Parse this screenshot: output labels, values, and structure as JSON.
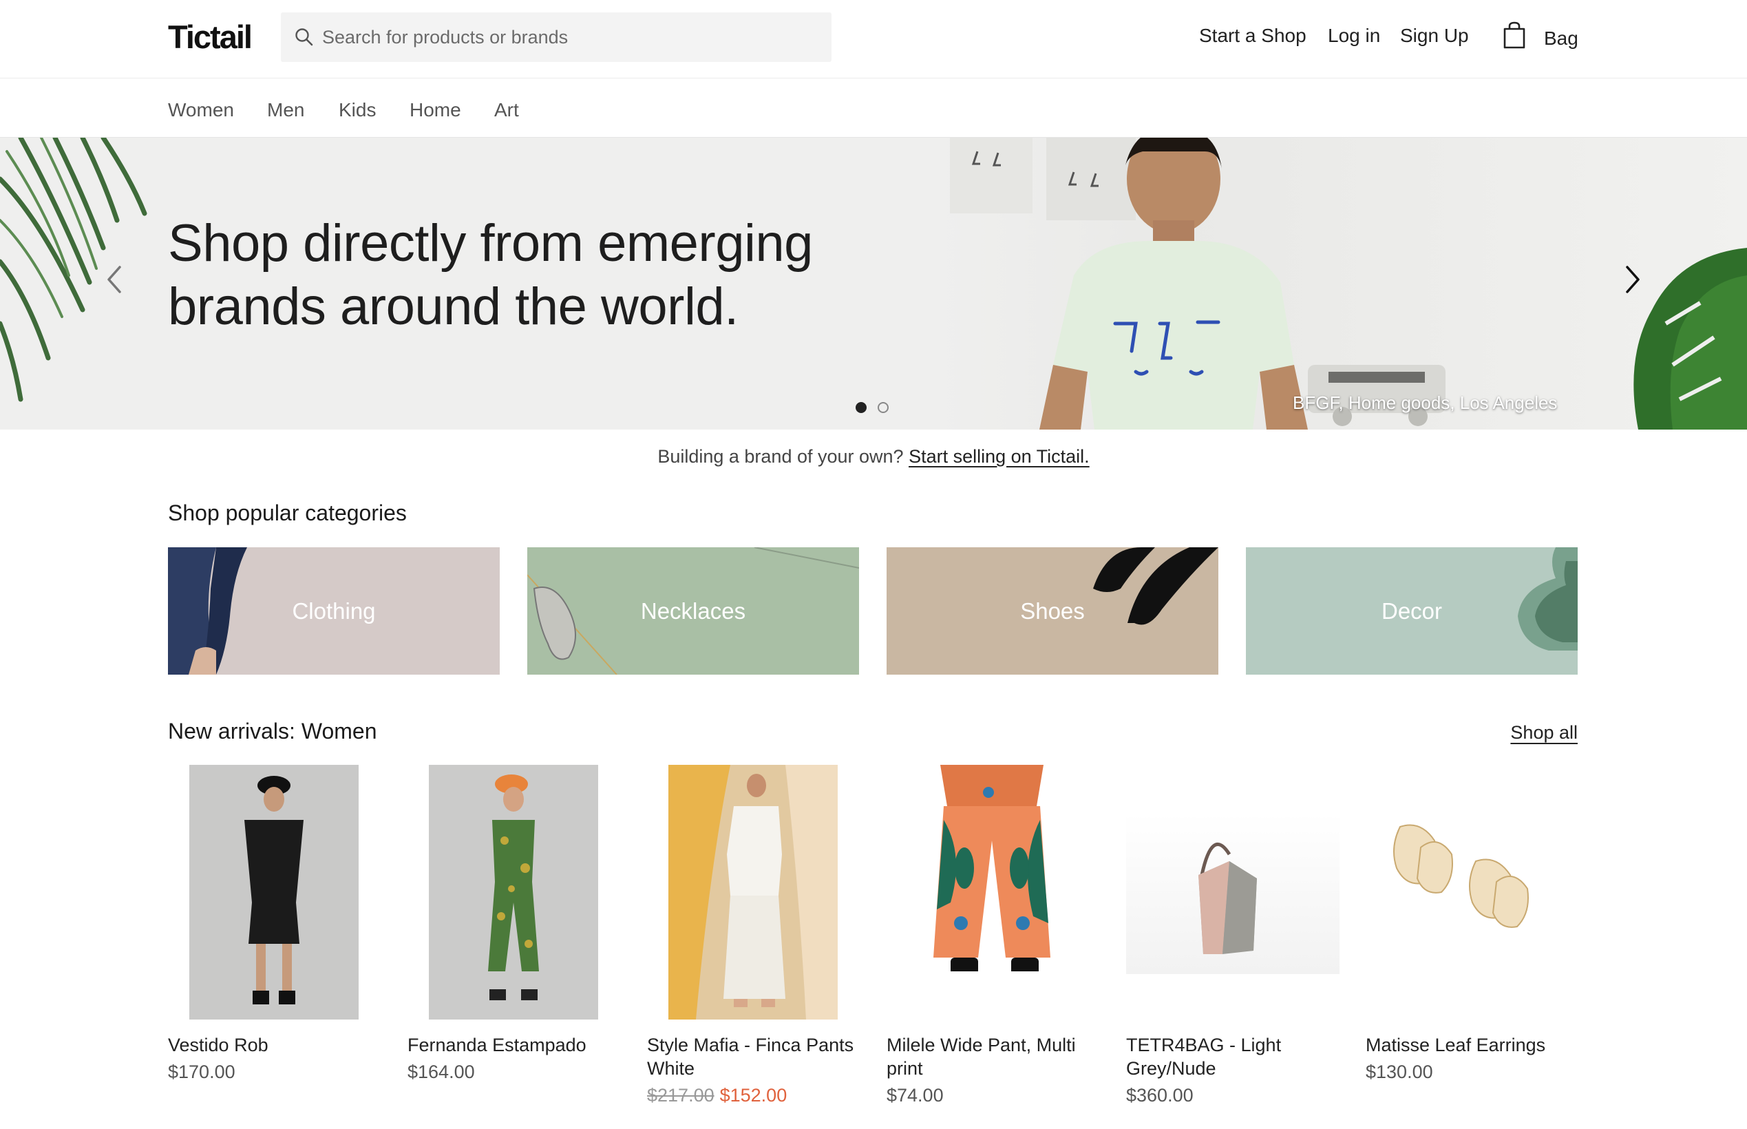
{
  "header": {
    "logo": "Tictail",
    "search_placeholder": "Search for products or brands",
    "links": {
      "start_shop": "Start a Shop",
      "login": "Log in",
      "signup": "Sign Up"
    },
    "bag_label": "Bag"
  },
  "nav": [
    "Women",
    "Men",
    "Kids",
    "Home",
    "Art"
  ],
  "hero": {
    "headline_line1": "Shop directly from emerging",
    "headline_line2": "brands around the world.",
    "caption": "BFGF, Home goods, Los Angeles",
    "slide_count": 2,
    "active_slide": 1
  },
  "sell_banner": {
    "text": "Building a brand of your own? ",
    "link": "Start selling on Tictail."
  },
  "popular_categories": {
    "title": "Shop popular categories",
    "items": [
      {
        "label": "Clothing",
        "color": "#d5cac8"
      },
      {
        "label": "Necklaces",
        "color": "#a9bfa5"
      },
      {
        "label": "Shoes",
        "color": "#c9b7a2"
      },
      {
        "label": "Decor",
        "color": "#b5cbc1"
      }
    ]
  },
  "new_arrivals": {
    "title": "New arrivals: Women",
    "shop_all": "Shop all",
    "products": [
      {
        "name": "Vestido Rob",
        "price": "$170.00"
      },
      {
        "name": "Fernanda Estampado",
        "price": "$164.00"
      },
      {
        "name": "Style Mafia - Finca Pants White",
        "old_price": "$217.00",
        "sale_price": "$152.00"
      },
      {
        "name": "Milele Wide Pant, Multi print",
        "price": "$74.00"
      },
      {
        "name": "TETR4BAG - Light Grey/Nude",
        "price": "$360.00"
      },
      {
        "name": "Matisse Leaf Earrings",
        "price": "$130.00"
      }
    ]
  },
  "icons": [
    "search-icon",
    "bag-icon",
    "chevron-left-icon",
    "chevron-right-icon"
  ]
}
